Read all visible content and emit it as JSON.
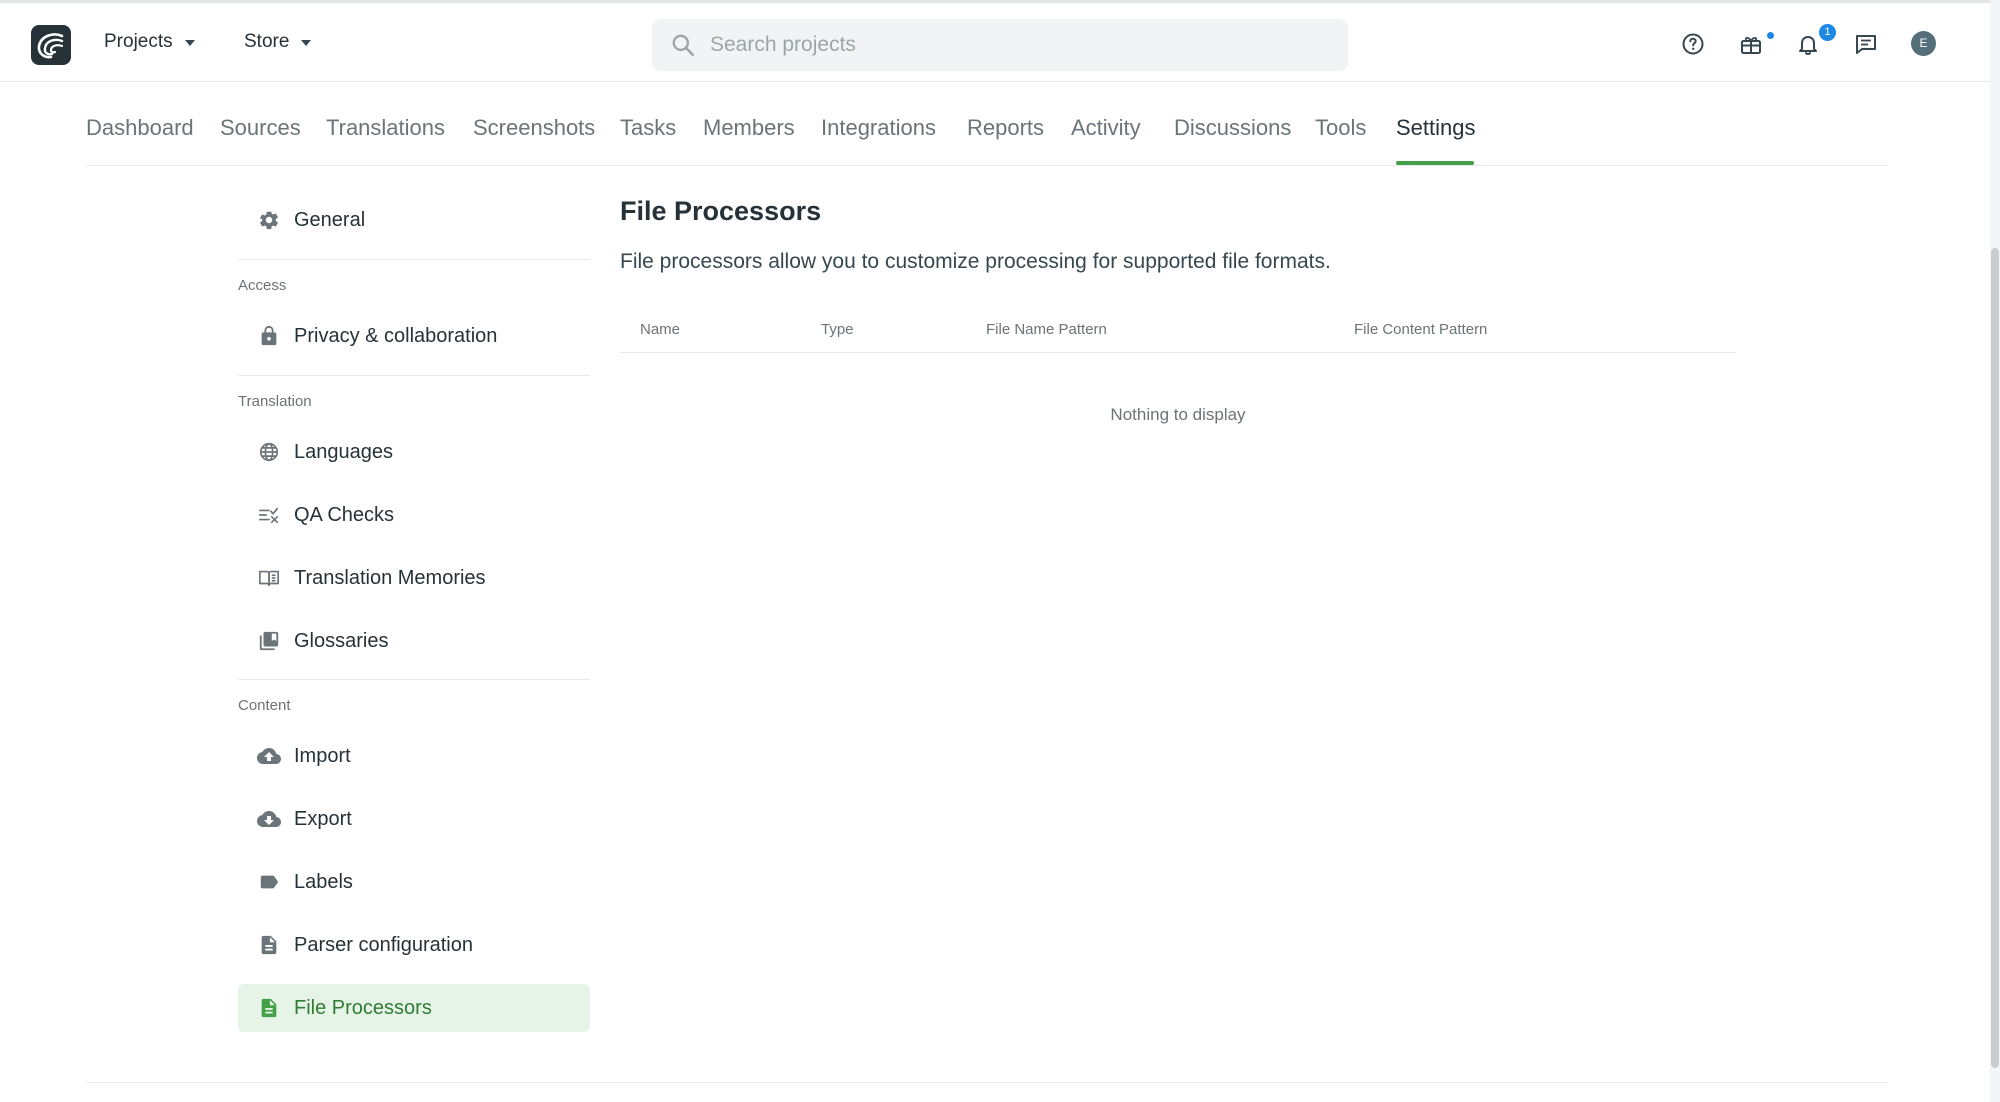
{
  "header": {
    "projects_label": "Projects",
    "store_label": "Store",
    "search_placeholder": "Search projects",
    "notification_count": "1",
    "avatar_initial": "E"
  },
  "tabs": [
    {
      "label": "Dashboard"
    },
    {
      "label": "Sources"
    },
    {
      "label": "Translations"
    },
    {
      "label": "Screenshots"
    },
    {
      "label": "Tasks"
    },
    {
      "label": "Members"
    },
    {
      "label": "Integrations"
    },
    {
      "label": "Reports"
    },
    {
      "label": "Activity"
    },
    {
      "label": "Discussions"
    },
    {
      "label": "Tools"
    },
    {
      "label": "Settings",
      "active": true
    }
  ],
  "sidebar": {
    "general": {
      "label": "General",
      "icon": "gear-icon"
    },
    "groups": {
      "access": "Access",
      "translation": "Translation",
      "content": "Content"
    },
    "items": {
      "privacy": {
        "label": "Privacy & collaboration",
        "icon": "lock-icon"
      },
      "languages": {
        "label": "Languages",
        "icon": "globe-icon"
      },
      "qa_checks": {
        "label": "QA Checks",
        "icon": "qa-checks-icon"
      },
      "translation_memories": {
        "label": "Translation Memories",
        "icon": "book-icon"
      },
      "glossaries": {
        "label": "Glossaries",
        "icon": "library-icon"
      },
      "import": {
        "label": "Import",
        "icon": "cloud-upload-icon"
      },
      "export": {
        "label": "Export",
        "icon": "cloud-download-icon"
      },
      "labels": {
        "label": "Labels",
        "icon": "label-icon"
      },
      "parser_configuration": {
        "label": "Parser configuration",
        "icon": "document-icon"
      },
      "file_processors": {
        "label": "File Processors",
        "icon": "document-icon",
        "active": true
      }
    }
  },
  "main": {
    "title": "File Processors",
    "description": "File processors allow you to customize processing for supported file formats.",
    "columns": [
      "Name",
      "Type",
      "File Name Pattern",
      "File Content Pattern"
    ],
    "empty_text": "Nothing to display"
  },
  "colors": {
    "accent": "#43a047",
    "active_bg": "#e6f4e8",
    "badge": "#1e88e5"
  }
}
